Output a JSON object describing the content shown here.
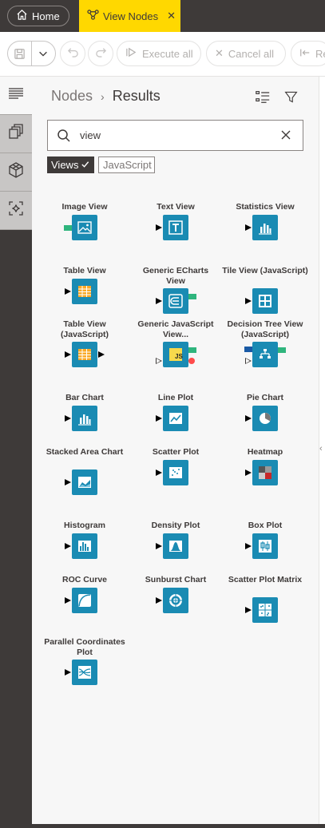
{
  "tabs": {
    "home_label": "Home",
    "active_label": "View Nodes"
  },
  "toolbar": {
    "execute_all": "Execute all",
    "cancel_all": "Cancel all",
    "reset_truncated": "Re"
  },
  "panel": {
    "breadcrumb_parent": "Nodes",
    "breadcrumb_current": "Results",
    "search_value": "view",
    "chip_selected": "Views",
    "chip_unselected": "JavaScript"
  },
  "nodes": [
    {
      "label": "Image View",
      "icon": "image-icon"
    },
    {
      "label": "Text View",
      "icon": "text-t-icon"
    },
    {
      "label": "Statistics View",
      "icon": "bar-chart-icon"
    },
    {
      "label": "Table View",
      "icon": "table-icon"
    },
    {
      "label": "Generic ECharts View",
      "icon": "echarts-icon"
    },
    {
      "label": "Tile View (JavaScript)",
      "icon": "tiles-icon"
    },
    {
      "label": "Table View (JavaScript)",
      "icon": "table-icon"
    },
    {
      "label": "Generic JavaScript View...",
      "icon": "js-icon"
    },
    {
      "label": "Decision Tree View (JavaScript)",
      "icon": "tree-icon"
    },
    {
      "label": "Bar Chart",
      "icon": "bar-chart-icon"
    },
    {
      "label": "Line Plot",
      "icon": "line-plot-icon"
    },
    {
      "label": "Pie Chart",
      "icon": "pie-chart-icon"
    },
    {
      "label": "Stacked Area Chart",
      "icon": "stacked-area-icon"
    },
    {
      "label": "Scatter Plot",
      "icon": "scatter-icon"
    },
    {
      "label": "Heatmap",
      "icon": "heatmap-icon"
    },
    {
      "label": "Histogram",
      "icon": "histogram-icon"
    },
    {
      "label": "Density Plot",
      "icon": "density-icon"
    },
    {
      "label": "Box Plot",
      "icon": "box-plot-icon"
    },
    {
      "label": "ROC Curve",
      "icon": "roc-curve-icon"
    },
    {
      "label": "Sunburst Chart",
      "icon": "sunburst-icon"
    },
    {
      "label": "Scatter Plot Matrix",
      "icon": "scatter-matrix-icon"
    },
    {
      "label": "Parallel Coordinates Plot",
      "icon": "parallel-coords-icon"
    }
  ],
  "colors": {
    "accent": "#ffd800",
    "dark": "#3e3a39",
    "node_view": "#1a8bb3",
    "port_image": "#2fb57d"
  }
}
